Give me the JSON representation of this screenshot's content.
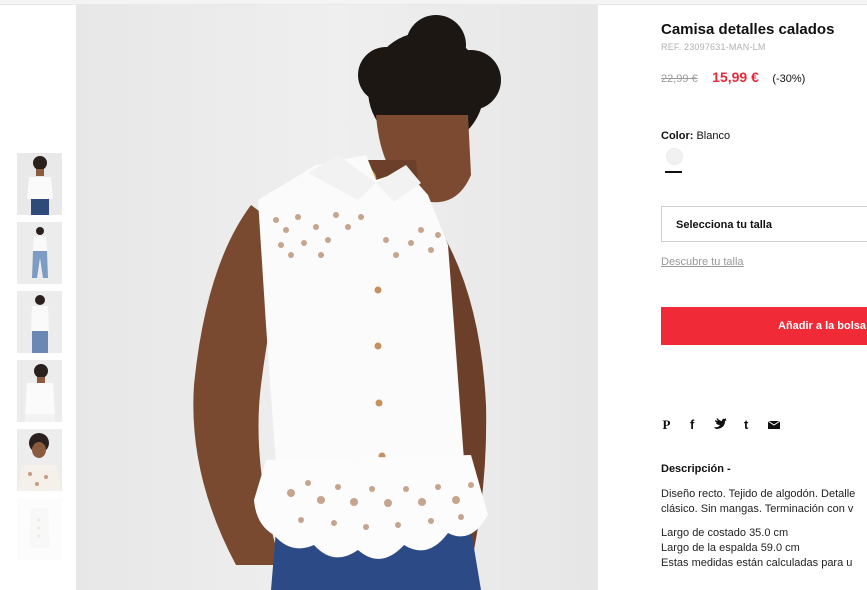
{
  "product": {
    "title": "Camisa detalles calados",
    "ref": "REF. 23097631-MAN-LM",
    "old_price": "22,99 €",
    "new_price": "15,99 €",
    "discount": "(-30%)"
  },
  "color": {
    "label": "Color:",
    "value": "Blanco",
    "swatch_color": "#f1f1f1"
  },
  "size": {
    "select_label": "Selecciona tu talla",
    "guide_link": "Descubre tu talla"
  },
  "cart": {
    "add_button": "Añadir a la bolsa"
  },
  "share": {
    "icons": [
      "pinterest-icon",
      "facebook-icon",
      "twitter-icon",
      "tumblr-icon",
      "email-icon"
    ]
  },
  "description": {
    "title": "Descripción -",
    "line1": "Diseño recto. Tejido de algodón. Detalle",
    "line2": "clásico. Sin mangas. Terminación con v",
    "measure1": "Largo de costado 35.0 cm",
    "measure2": "Largo de la espalda 59.0 cm",
    "measure3": "Estas medidas están calculadas para u"
  },
  "theme": {
    "accent": "#f12a37",
    "price_red": "#e8283b"
  }
}
